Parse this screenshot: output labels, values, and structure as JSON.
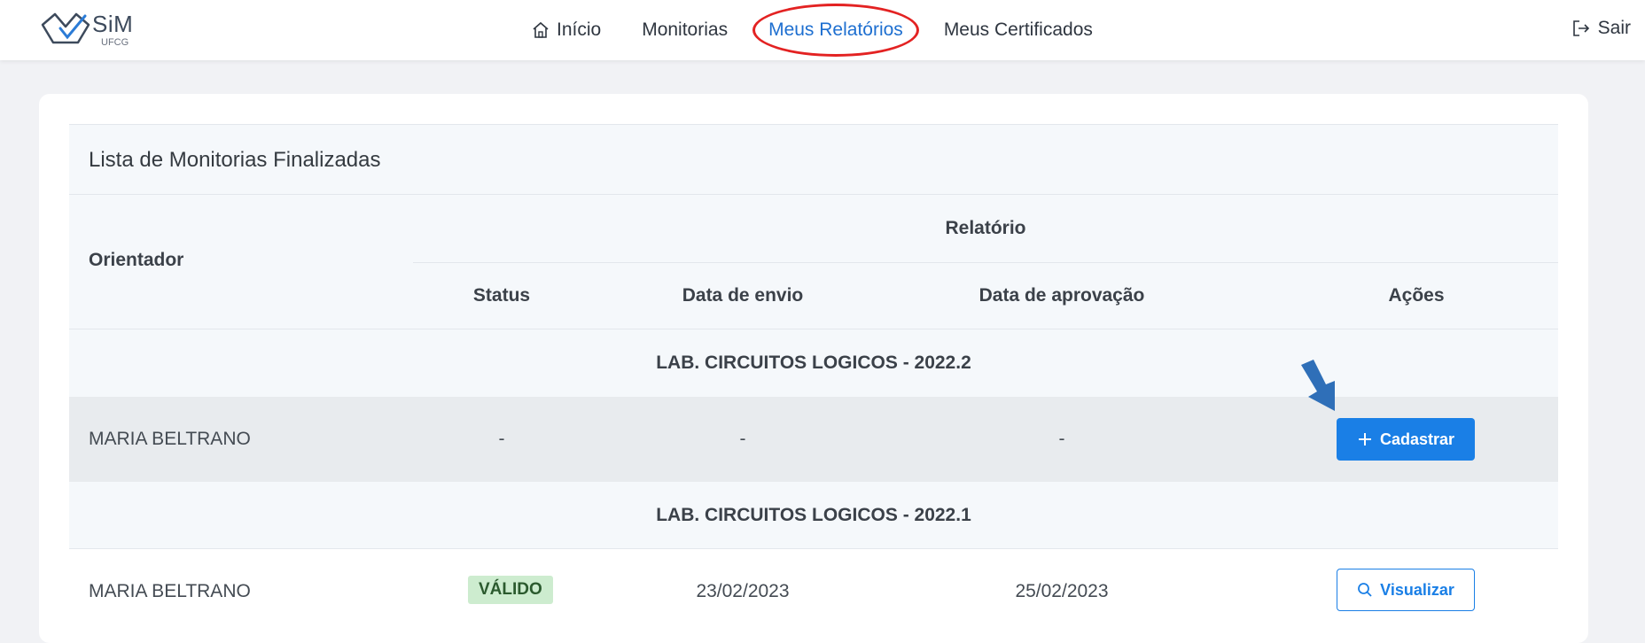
{
  "brand": {
    "name": "SiM",
    "sub": "UFCG"
  },
  "nav": {
    "items": [
      {
        "label": "Início",
        "icon": "home-icon"
      },
      {
        "label": "Monitorias"
      },
      {
        "label": "Meus Relatórios",
        "active": true
      },
      {
        "label": "Meus Certificados"
      }
    ],
    "logout_label": "Sair"
  },
  "table": {
    "title": "Lista de Monitorias Finalizadas",
    "header": {
      "orientador": "Orientador",
      "relatorio": "Relatório",
      "status": "Status",
      "data_envio": "Data de envio",
      "data_aprovacao": "Data de aprovação",
      "acoes": "Ações"
    },
    "groups": [
      {
        "label": "LAB. CIRCUITOS LOGICOS - 2022.2",
        "row": {
          "orientador": "MARIA BELTRANO",
          "status": "-",
          "data_envio": "-",
          "data_aprovacao": "-",
          "action_label": "Cadastrar",
          "action_icon": "plus-icon"
        }
      },
      {
        "label": "LAB. CIRCUITOS LOGICOS - 2022.1",
        "row": {
          "orientador": "MARIA BELTRANO",
          "status": "VÁLIDO",
          "data_envio": "23/02/2023",
          "data_aprovacao": "25/02/2023",
          "action_label": "Visualizar",
          "action_icon": "search-icon"
        }
      }
    ]
  },
  "colors": {
    "accent": "#1a7fe6",
    "active_nav": "#1e6fd0",
    "highlight_ring": "#e32222",
    "annotation_arrow": "#2f6fb8",
    "valid_badge_bg": "#cdeccf"
  }
}
